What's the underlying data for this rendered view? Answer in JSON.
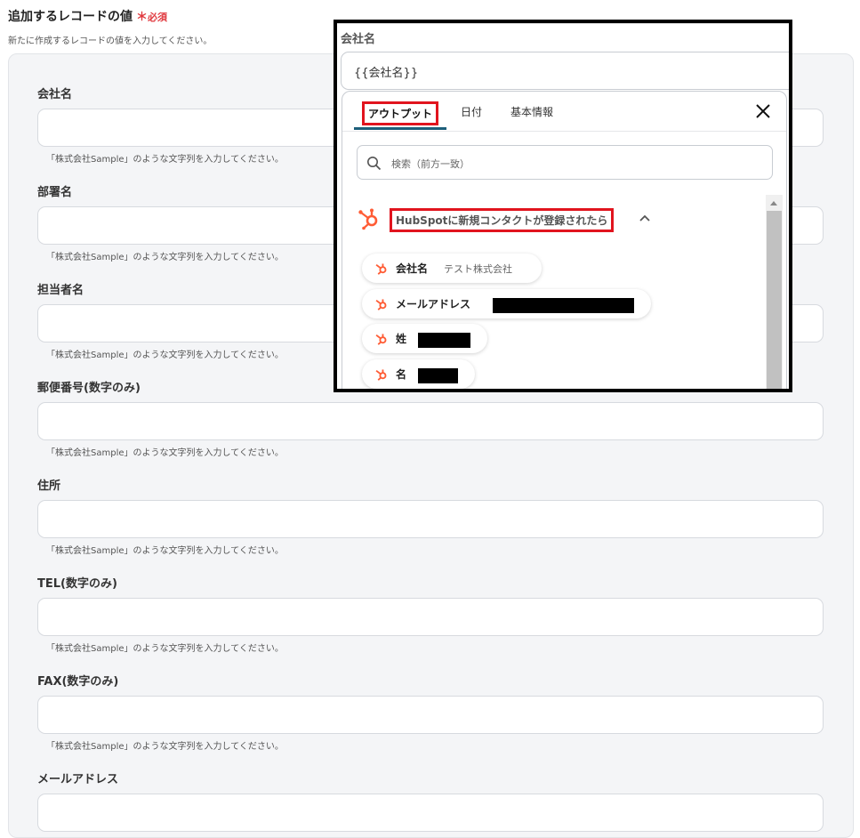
{
  "section": {
    "title": "追加するレコードの値",
    "required_mark": "＊",
    "required_label": "必須",
    "description": "新たに作成するレコードの値を入力してください。"
  },
  "fields": [
    {
      "label": "会社名",
      "value": "",
      "hint": "「株式会社Sample」のような文字列を入力してください。"
    },
    {
      "label": "部署名",
      "value": "",
      "hint": "「株式会社Sample」のような文字列を入力してください。"
    },
    {
      "label": "担当者名",
      "value": "",
      "hint": "「株式会社Sample」のような文字列を入力してください。"
    },
    {
      "label": "郵便番号(数字のみ)",
      "value": "",
      "hint": "「株式会社Sample」のような文字列を入力してください。"
    },
    {
      "label": "住所",
      "value": "",
      "hint": "「株式会社Sample」のような文字列を入力してください。"
    },
    {
      "label": "TEL(数字のみ)",
      "value": "",
      "hint": "「株式会社Sample」のような文字列を入力してください。"
    },
    {
      "label": "FAX(数字のみ)",
      "value": "",
      "hint": "「株式会社Sample」のような文字列を入力してください。"
    },
    {
      "label": "メールアドレス",
      "value": ""
    }
  ],
  "overlay": {
    "field_label": "会社名",
    "field_value": "{{会社名}}",
    "tabs": [
      "アウトプット",
      "日付",
      "基本情報"
    ],
    "search_placeholder": "検索（前方一致）",
    "group_title": "HubSpotに新規コンタクトが登録されたら",
    "items": [
      {
        "name": "会社名",
        "value": "テスト株式会社"
      },
      {
        "name": "メールアドレス",
        "value": ""
      },
      {
        "name": "姓",
        "value": ""
      },
      {
        "name": "名",
        "value": ""
      }
    ],
    "colors": {
      "accent_red": "#e1141e",
      "hubspot_orange": "#ff5c35",
      "tab_underline": "#1d5f7a"
    }
  }
}
